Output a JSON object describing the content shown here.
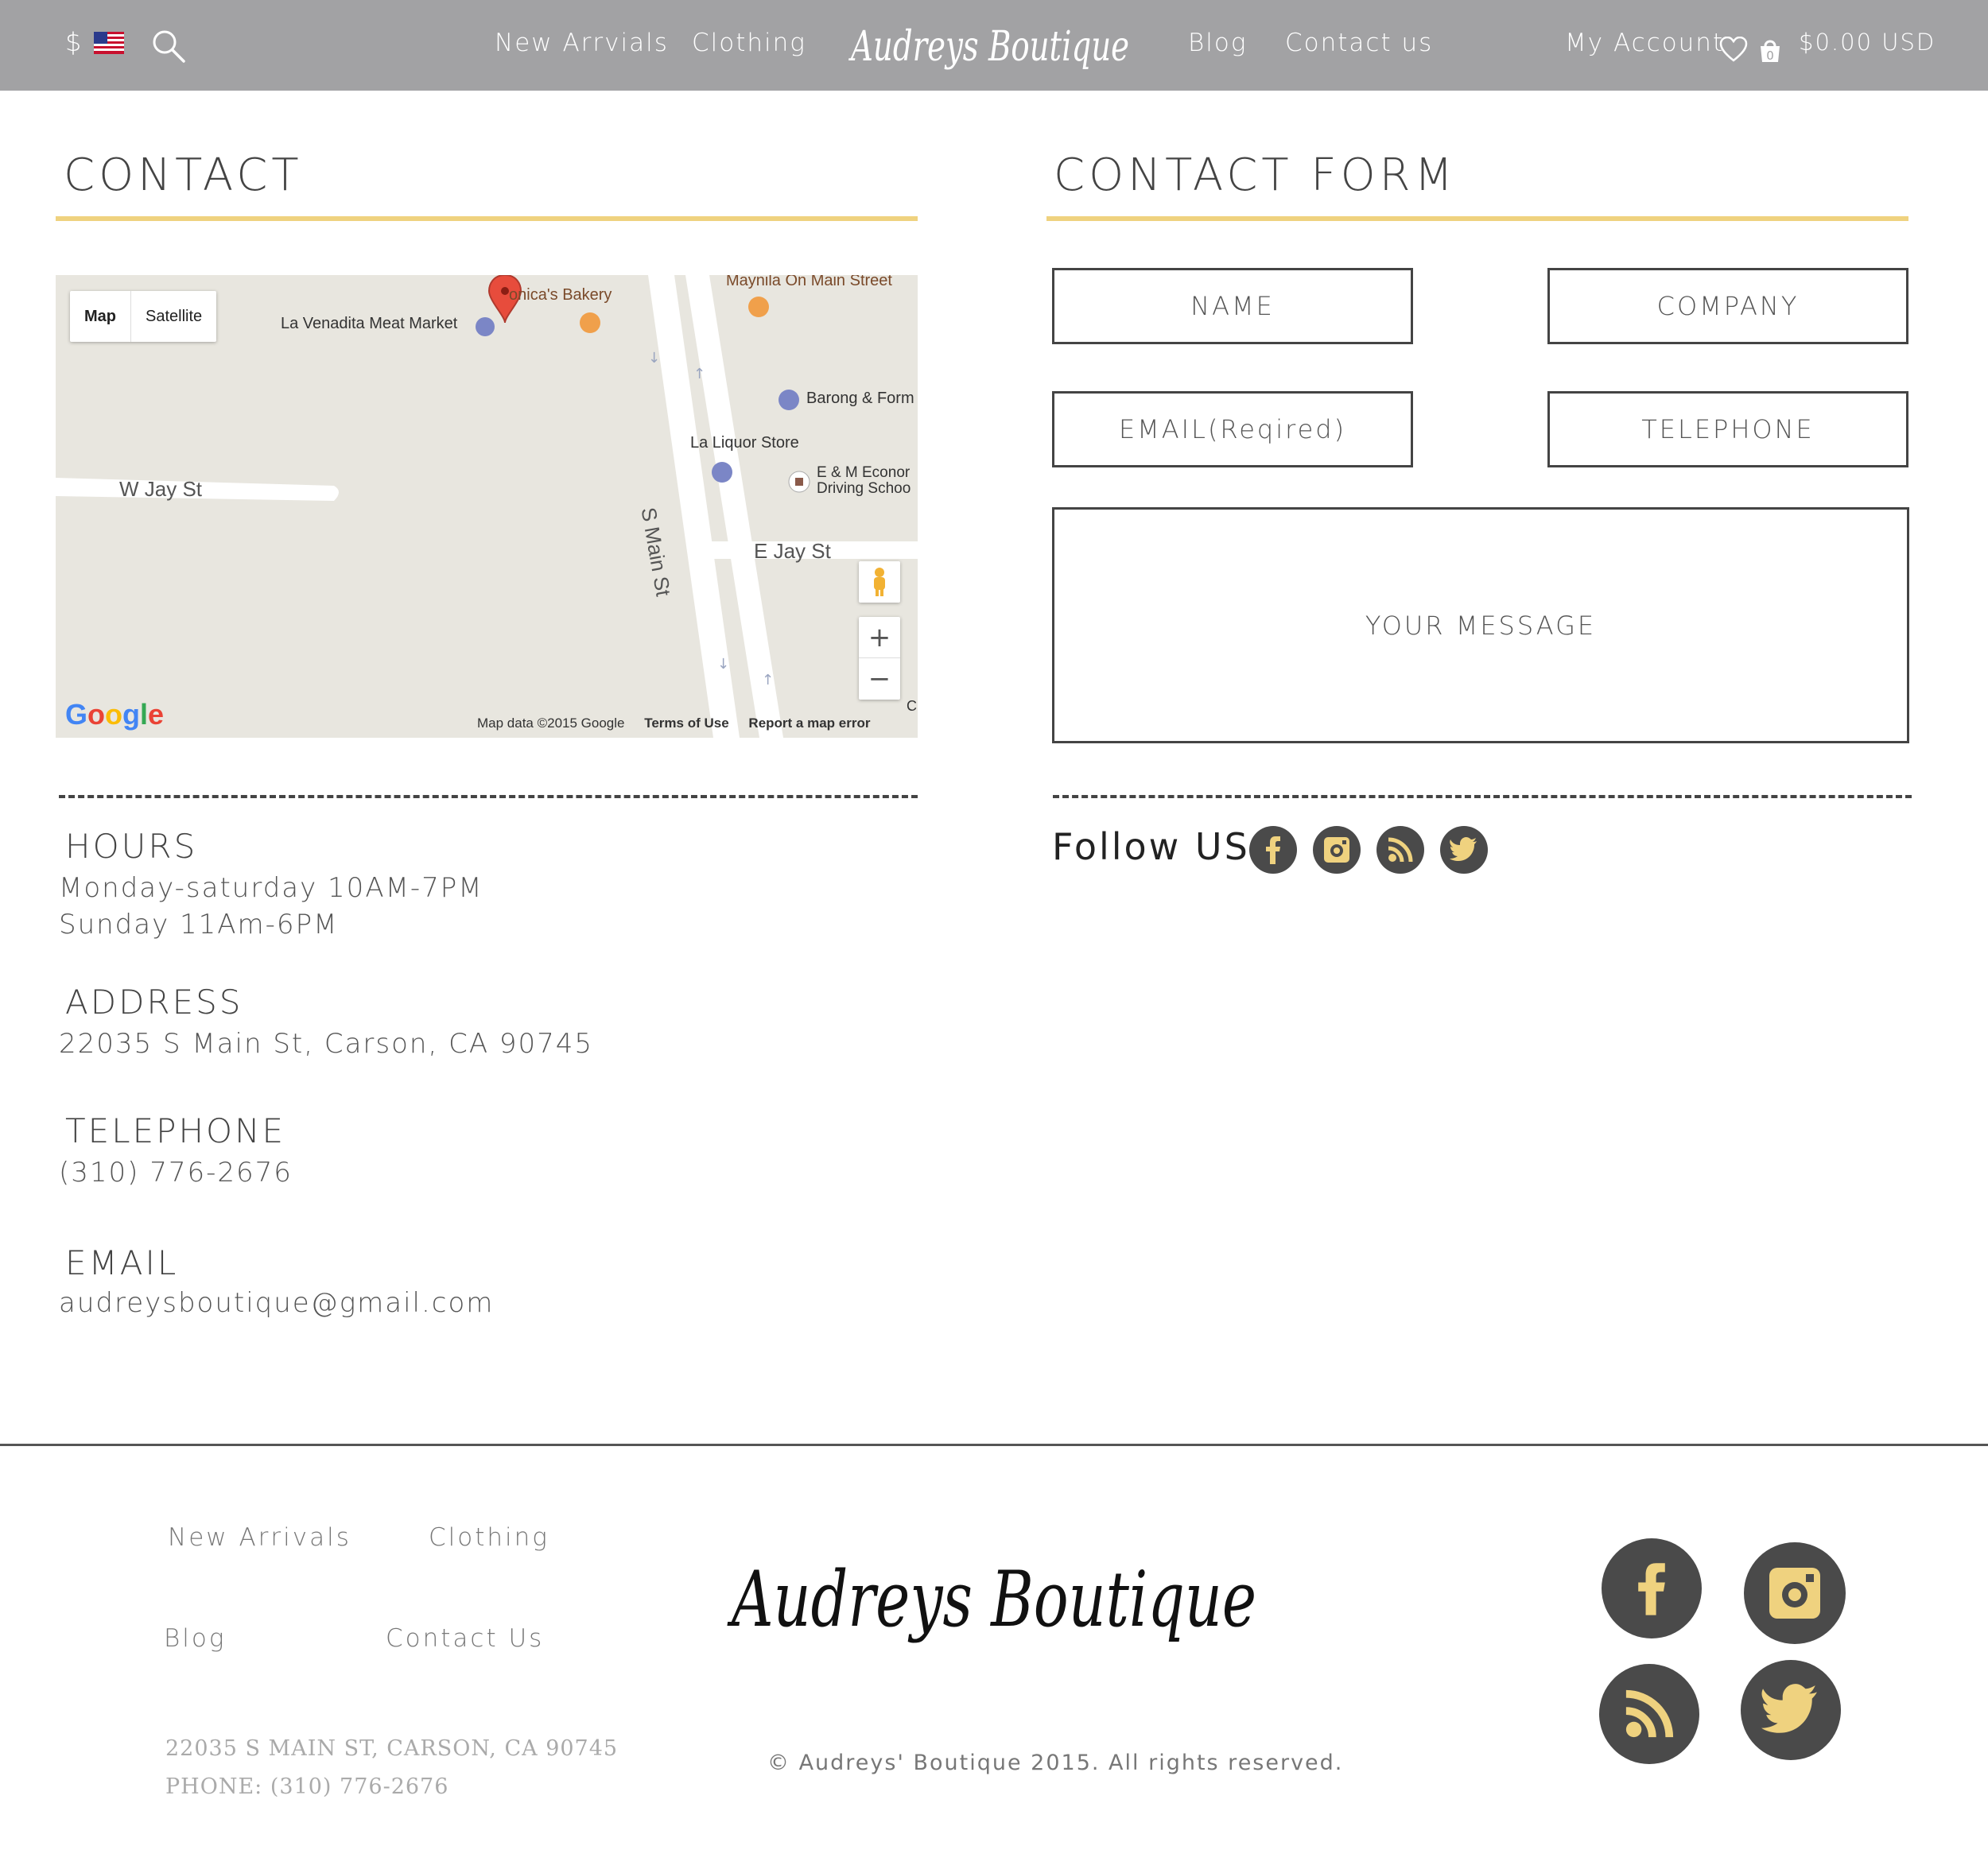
{
  "header": {
    "currency": "$",
    "nav_left": [
      "New Arrvials",
      "Clothing"
    ],
    "logo_text": "Audreys Boutique",
    "nav_right": [
      "Blog",
      "Contact us"
    ],
    "account": "My Account",
    "cart_count": "0",
    "cart_total": "$0.00 USD"
  },
  "contact": {
    "title": "CONTACT",
    "hours_heading": "HOURS",
    "hours_lines": [
      "Monday-saturday 10AM-7PM",
      "Sunday 11Am-6PM"
    ],
    "address_heading": "ADDRESS",
    "address": "22035 S Main St, Carson, CA 90745",
    "telephone_heading": "TELEPHONE",
    "telephone": "(310) 776-2676",
    "email_heading": "EMAIL",
    "email": "audreysboutique@gmail.com"
  },
  "map": {
    "toggle_map": "Map",
    "toggle_satellite": "Satellite",
    "places": {
      "bakery": "onica's Bakery",
      "meat_market": "La Venadita Meat Market",
      "maynila": "Maynila On Main Street",
      "barong": "Barong & Form",
      "liquor": "La Liquor Store",
      "econ_1": "E & M Econor",
      "econ_2": "Driving Schoo",
      "w_jay": "W Jay St",
      "e_jay": "E Jay St",
      "s_main": "S Main St",
      "edge": "C"
    },
    "zoom_in": "+",
    "zoom_out": "−",
    "google": [
      "G",
      "o",
      "o",
      "g",
      "l",
      "e"
    ],
    "map_data": "Map data ©2015 Google",
    "terms": "Terms of Use",
    "report": "Report a map error"
  },
  "form": {
    "title": "CONTACT FORM",
    "name_placeholder": "NAME",
    "company_placeholder": "COMPANY",
    "email_placeholder": "EMAIL(Reqired)",
    "telephone_placeholder": "TELEPHONE",
    "message_placeholder": "YOUR MESSAGE"
  },
  "follow": {
    "label": "Follow US",
    "networks": [
      "facebook",
      "instagram",
      "rss",
      "twitter"
    ]
  },
  "footer": {
    "links": [
      "New Arrivals",
      "Clothing",
      "Blog",
      "Contact Us"
    ],
    "address": "22035 S MAIN ST, CARSON, CA 90745",
    "phone": "PHONE: (310) 776-2676",
    "logo_text": "Audreys Boutique",
    "copyright": "© Audreys' Boutique 2015. All rights reserved."
  },
  "colors": {
    "header_bg": "#a2a2a4",
    "accent_gold": "#efd27f",
    "social_bg": "#4a4a4a",
    "text_dark": "#444444"
  }
}
